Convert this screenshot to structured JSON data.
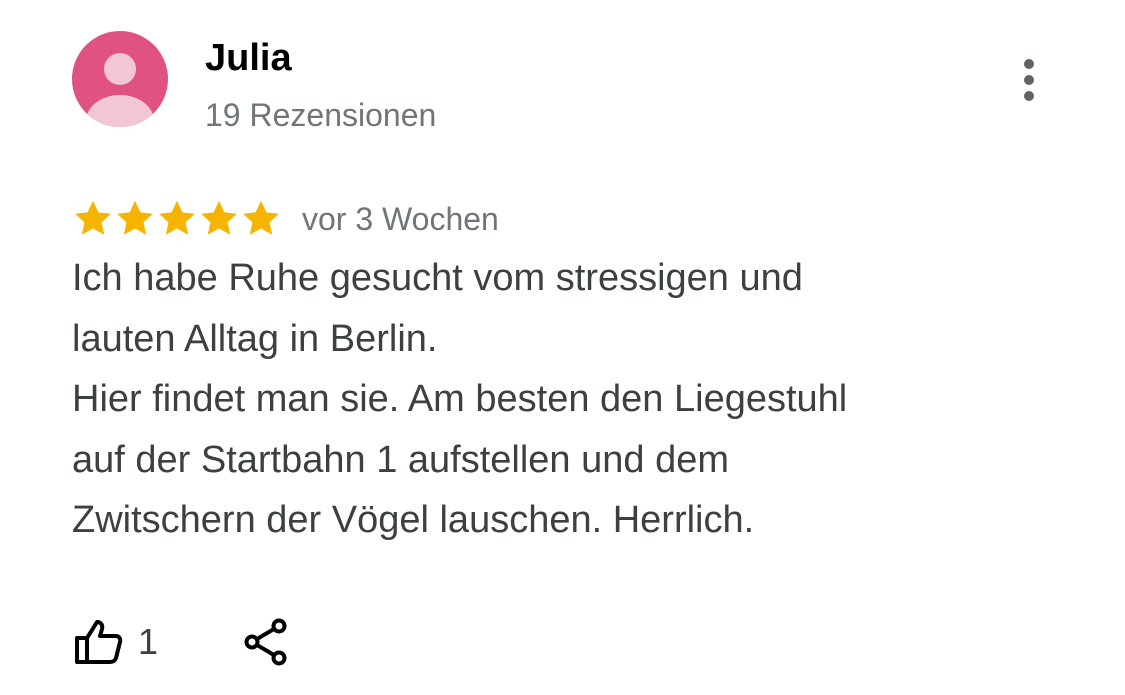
{
  "review": {
    "author": {
      "name": "Julia",
      "review_count": "19 Rezensionen",
      "avatar_icon": "person-avatar-icon",
      "avatar_color": "#e0527f"
    },
    "more_icon": "more-vertical-icon",
    "rating": {
      "stars": 5,
      "max": 5,
      "star_color": "#f4b400",
      "date": "vor 3 Wochen"
    },
    "text_lines": [
      "Ich habe Ruhe gesucht vom stressigen und",
      "lauten Alltag in Berlin.",
      "Hier findet man sie. Am besten den Liegestuhl",
      "auf der Startbahn 1 aufstellen und dem",
      "Zwitschern der Vögel lauschen. Herrlich."
    ],
    "actions": {
      "like_icon": "thumbs-up-icon",
      "like_count": "1",
      "share_icon": "share-icon"
    }
  }
}
